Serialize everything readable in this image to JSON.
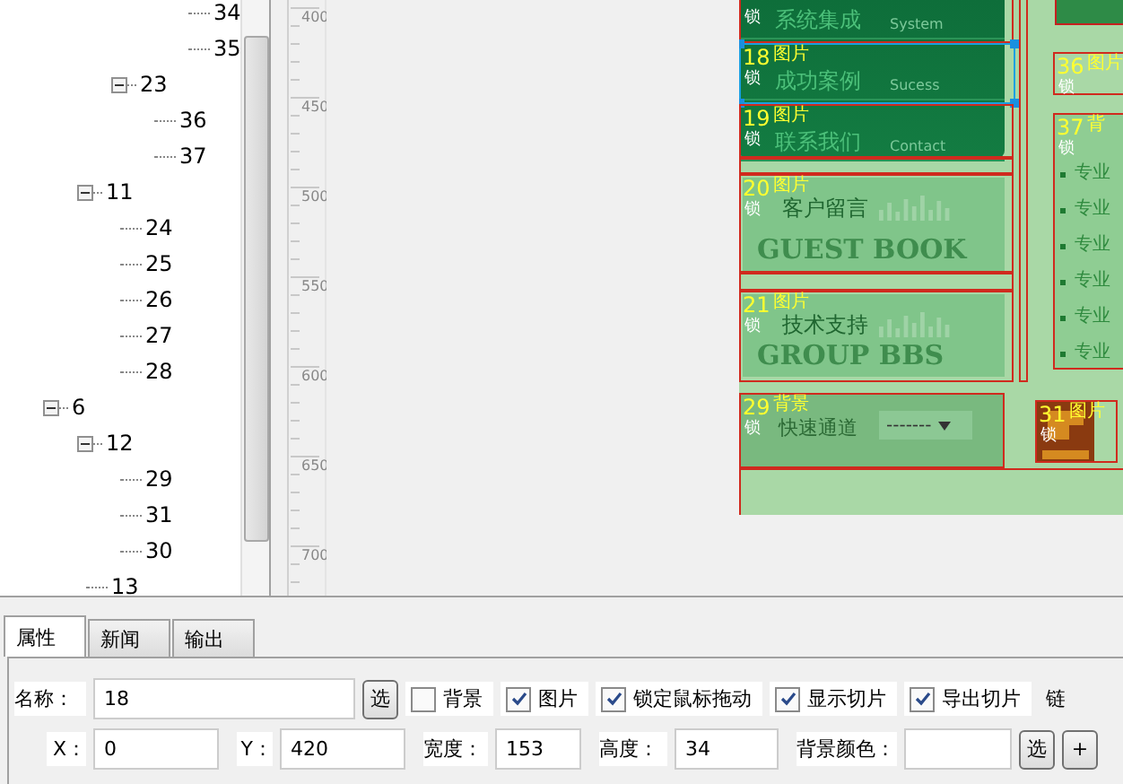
{
  "tree": {
    "items": [
      {
        "children": [
          {
            "children": [
              {
                "children": [
                  {
                    "children": [
                      {
                        "label": "34"
                      },
                      {
                        "label": "35"
                      }
                    ]
                  }
                ]
              },
              {
                "label": "23",
                "expanded": true,
                "children": [
                  {
                    "label": "36"
                  },
                  {
                    "label": "37"
                  }
                ]
              }
            ]
          },
          {
            "label": "11",
            "expanded": true,
            "children": [
              {
                "label": "24"
              },
              {
                "label": "25"
              },
              {
                "label": "26"
              },
              {
                "label": "27"
              },
              {
                "label": "28"
              }
            ]
          }
        ]
      },
      {
        "label": "6",
        "expanded": true,
        "children": [
          {
            "label": "12",
            "expanded": true,
            "children": [
              {
                "label": "29"
              },
              {
                "label": "31"
              },
              {
                "label": "30"
              }
            ]
          },
          {
            "label": "13"
          }
        ]
      }
    ]
  },
  "ruler": {
    "labels": [
      "400",
      "450",
      "500",
      "550",
      "600",
      "650",
      "700"
    ]
  },
  "canvas": {
    "menu": [
      {
        "title": "系统集成",
        "subtitle": "System"
      },
      {
        "title": "成功案例",
        "subtitle": "Sucess"
      },
      {
        "title": "联系我们",
        "subtitle": "Contact"
      }
    ],
    "banners": [
      {
        "title": "客户留言",
        "subtitle": "GUEST BOOK"
      },
      {
        "title": "技术支持",
        "subtitle": "GROUP BBS"
      }
    ],
    "quick_link": {
      "label": "快速通道",
      "select": "-------"
    },
    "news_list": [
      "专业",
      "专业",
      "专业",
      "专业",
      "专业",
      "专业"
    ],
    "slices": [
      {
        "lock": "锁",
        "selected": false
      },
      {
        "number": "18",
        "type": "图片",
        "lock": "锁",
        "selected": true
      },
      {
        "number": "36",
        "type": "图片",
        "lock": "锁",
        "selected": false
      },
      {
        "number": "19",
        "type": "图片",
        "lock": "锁",
        "selected": false
      },
      {
        "number": "37",
        "type": "背",
        "lock": "锁",
        "selected": false
      },
      {
        "number": "20",
        "type": "图片",
        "lock": "锁",
        "selected": false
      },
      {
        "number": "21",
        "type": "图片",
        "lock": "锁",
        "selected": false
      },
      {
        "number": "29",
        "type": "背景",
        "lock": "锁",
        "selected": false
      },
      {
        "number": "31",
        "type": "图片",
        "lock": "锁",
        "selected": false
      }
    ]
  },
  "tabs": [
    {
      "label": "属性",
      "selected": true
    },
    {
      "label": "新闻",
      "selected": false
    },
    {
      "label": "输出",
      "selected": false
    }
  ],
  "properties": {
    "name": {
      "label": "名称：",
      "value": "18",
      "button": "选"
    },
    "checkboxes": [
      {
        "label": "背景",
        "checked": false
      },
      {
        "label": "图片",
        "checked": true
      },
      {
        "label": "锁定鼠标拖动",
        "checked": true
      },
      {
        "label": "显示切片",
        "checked": true
      },
      {
        "label": "导出切片",
        "checked": true
      }
    ],
    "cut_label": "链",
    "fields": [
      {
        "label": "X：",
        "value": "0"
      },
      {
        "label": "Y：",
        "value": "420"
      },
      {
        "label": "宽度：",
        "value": "153"
      },
      {
        "label": "高度：",
        "value": "34"
      },
      {
        "label": "背景颜色："
      }
    ],
    "color_buttons": [
      "选",
      "+"
    ]
  }
}
